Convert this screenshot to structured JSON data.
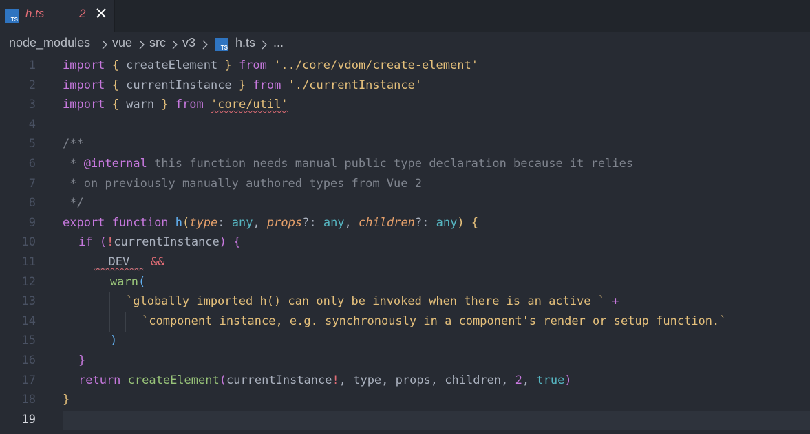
{
  "tab": {
    "filename": "h.ts",
    "problem_count": "2",
    "icon": "typescript-icon"
  },
  "breadcrumb": {
    "parts": [
      "node_modules",
      "vue",
      "src",
      "v3"
    ],
    "file": "h.ts",
    "more": "..."
  },
  "editor": {
    "current_line": 19,
    "line_numbers": [
      "1",
      "2",
      "3",
      "4",
      "5",
      "6",
      "7",
      "8",
      "9",
      "10",
      "11",
      "12",
      "13",
      "14",
      "15",
      "16",
      "17",
      "18",
      "19"
    ],
    "lines": {
      "l1": {
        "kw": "import",
        "ob": "{",
        "name": " createElement ",
        "cb": "}",
        "from": " from ",
        "str": "'../core/vdom/create-element'"
      },
      "l2": {
        "kw": "import",
        "ob": "{",
        "name": " currentInstance ",
        "cb": "}",
        "from": " from ",
        "str": "'./currentInstance'"
      },
      "l3": {
        "kw": "import",
        "ob": "{",
        "name": " warn ",
        "cb": "}",
        "from": " from ",
        "str": "'core/util'"
      },
      "l5": "/**",
      "l6": {
        "star": " * ",
        "tag": "@internal",
        "text": " this function needs manual public type declaration because it relies"
      },
      "l7": " * on previously manually authored types from Vue 2",
      "l8": " */",
      "l9": {
        "export": "export",
        "function": " function ",
        "name": "h",
        "open": "(",
        "p1": "type",
        "c1": ": ",
        "t1": "any",
        "sep1": ", ",
        "p2": "props",
        "q2": "?: ",
        "t2": "any",
        "sep2": ", ",
        "p3": "children",
        "q3": "?: ",
        "t3": "any",
        "close": ")",
        "brace": " {"
      },
      "l10": {
        "kw": "if",
        "sp": " ",
        "open": "(",
        "bang": "!",
        "name": "currentInstance",
        "close": ")",
        "brace": " {"
      },
      "l11": {
        "name": "__DEV__",
        "op": " &&"
      },
      "l12": {
        "fn": "warn",
        "open": "("
      },
      "l13": {
        "str": "`globally imported h() can only be invoked when there is an active ` ",
        "plus": "+"
      },
      "l14": "`component instance, e.g. synchronously in a component's render or setup function.`",
      "l15": ")",
      "l16": "}",
      "l17": {
        "kw": "return",
        "fn": " createElement",
        "open": "(",
        "a1": "currentInstance",
        "bang": "!",
        "rest": ", type, props, children, ",
        "num": "2",
        "sep": ", ",
        "bool": "true",
        "close": ")"
      },
      "l18": "}"
    }
  }
}
